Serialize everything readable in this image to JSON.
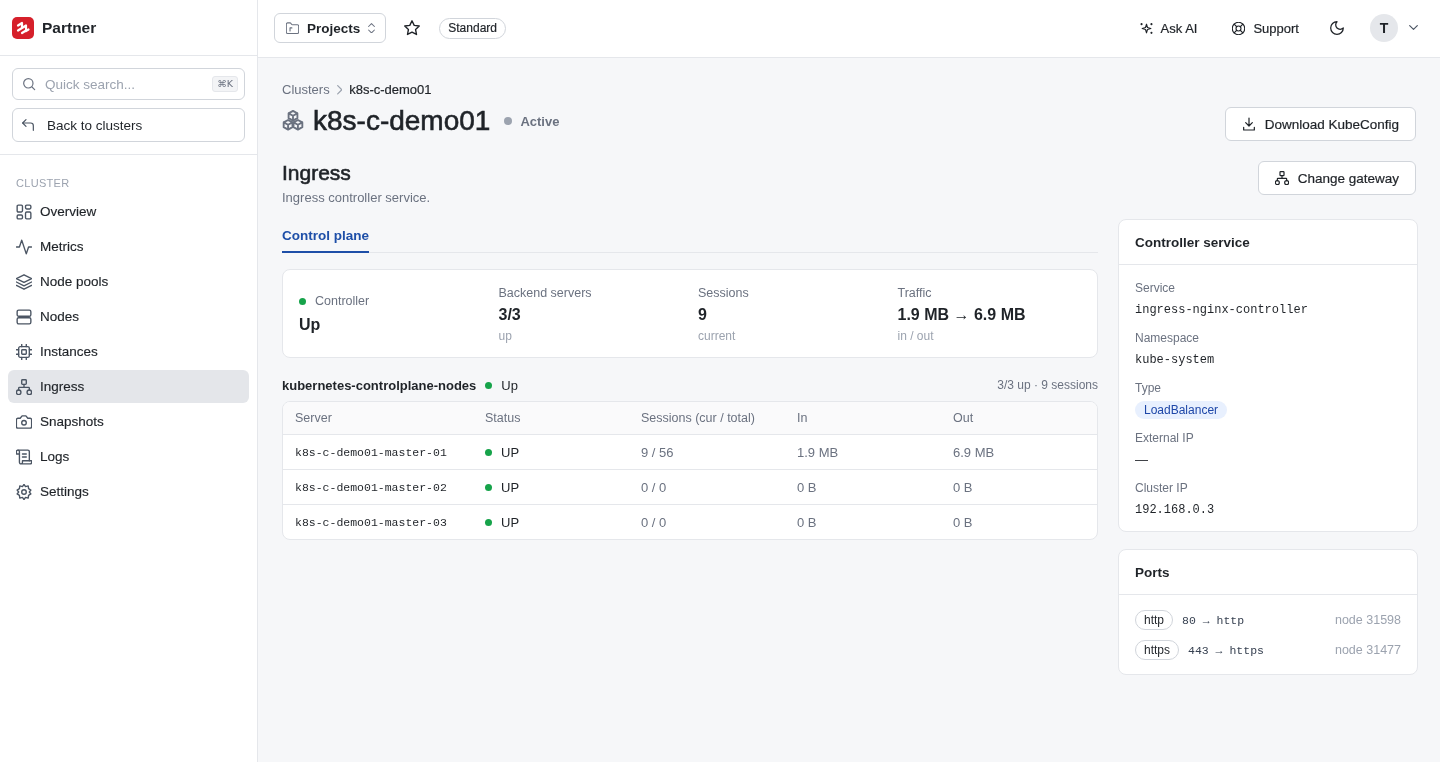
{
  "sidebar": {
    "brand": "Partner",
    "search": {
      "placeholder": "Quick search...",
      "shortcut": "⌘K"
    },
    "back_button": "Back to clusters",
    "section_label": "CLUSTER",
    "items": [
      {
        "label": "Overview",
        "selected": false
      },
      {
        "label": "Metrics",
        "selected": false
      },
      {
        "label": "Node pools",
        "selected": false
      },
      {
        "label": "Nodes",
        "selected": false
      },
      {
        "label": "Instances",
        "selected": false
      },
      {
        "label": "Ingress",
        "selected": true
      },
      {
        "label": "Snapshots",
        "selected": false
      },
      {
        "label": "Logs",
        "selected": false
      },
      {
        "label": "Settings",
        "selected": false
      }
    ]
  },
  "topbar": {
    "project_selector": "Projects",
    "plan_badge": "Standard",
    "actions": [
      "Ask AI",
      "Support"
    ],
    "avatar_initial": "T"
  },
  "page": {
    "breadcrumb": [
      "Clusters",
      "k8s-c-demo01"
    ],
    "title": "k8s-c-demo01",
    "status": "Active",
    "download_button": "Download KubeConfig"
  },
  "section": {
    "title": "Ingress",
    "description": "Ingress controller service.",
    "action_button": "Change gateway",
    "tabs": [
      {
        "label": "Control plane",
        "selected": true
      }
    ],
    "stats": [
      {
        "kind": "status",
        "label": "Controller",
        "value": "Up"
      },
      {
        "kind": "metric",
        "label": "Backend servers",
        "value": "3/3",
        "caption": "up"
      },
      {
        "kind": "metric",
        "label": "Sessions",
        "value": "9",
        "caption": "current"
      },
      {
        "kind": "metric",
        "label": "Traffic",
        "value": "1.9 MB → 6.9 MB",
        "caption": "in / out"
      }
    ],
    "backend": {
      "name": "kubernetes-controlplane-nodes",
      "status": "Up",
      "summary": "3/3 up · 9 sessions"
    },
    "table": {
      "columns": [
        "Server",
        "Status",
        "Sessions (cur / total)",
        "In",
        "Out"
      ],
      "rows": [
        {
          "server": "k8s-c-demo01-master-01",
          "status": "UP",
          "sessions": "9 / 56",
          "in": "1.9 MB",
          "out": "6.9 MB"
        },
        {
          "server": "k8s-c-demo01-master-02",
          "status": "UP",
          "sessions": "0 / 0",
          "in": "0 B",
          "out": "0 B"
        },
        {
          "server": "k8s-c-demo01-master-03",
          "status": "UP",
          "sessions": "0 / 0",
          "in": "0 B",
          "out": "0 B"
        }
      ]
    }
  },
  "controller_service": {
    "title": "Controller service",
    "fields": [
      {
        "kind": "mono",
        "label": "Service",
        "value": "ingress-nginx-controller"
      },
      {
        "kind": "mono",
        "label": "Namespace",
        "value": "kube-system"
      },
      {
        "kind": "badge",
        "label": "Type",
        "value": "LoadBalancer"
      },
      {
        "kind": "text",
        "label": "External IP",
        "value": "—"
      },
      {
        "kind": "mono",
        "label": "Cluster IP",
        "value": "192.168.0.3"
      }
    ]
  },
  "ports": {
    "title": "Ports",
    "items": [
      {
        "name": "http",
        "mapping": "80 → http",
        "node": "node 31598"
      },
      {
        "name": "https",
        "mapping": "443 → https",
        "node": "node 31477"
      }
    ]
  }
}
